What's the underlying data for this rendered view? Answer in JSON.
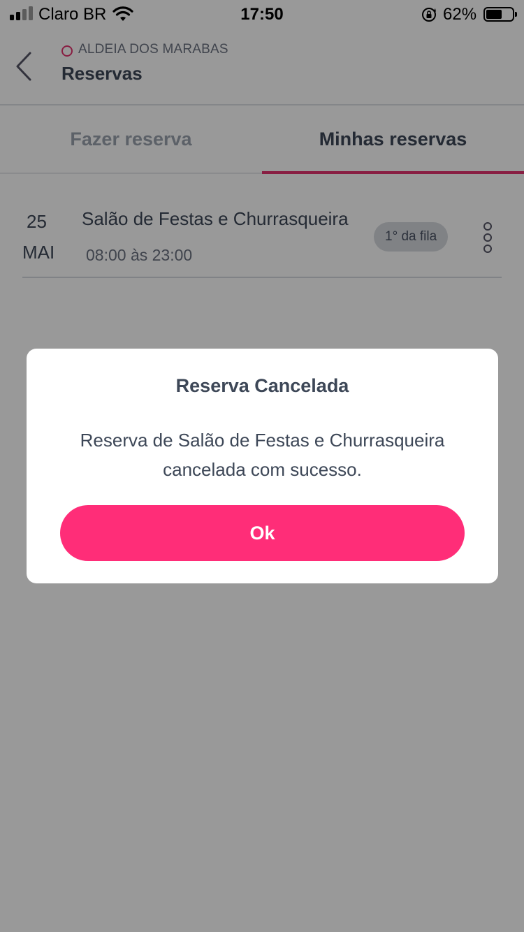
{
  "status_bar": {
    "carrier": "Claro BR",
    "time": "17:50",
    "battery_percent": "62%",
    "battery_level": 0.62,
    "signal_bars_active": 2,
    "signal_bars_total": 4
  },
  "header": {
    "condo_name": "ALDEIA DOS MARABAS",
    "title": "Reservas",
    "back_icon": "chevron-left-icon"
  },
  "tabs": [
    {
      "label": "Fazer reserva",
      "active": false
    },
    {
      "label": "Minhas reservas",
      "active": true
    }
  ],
  "reservations": [
    {
      "day": "25",
      "month": "MAI",
      "name": "Salão de Festas e Churrasqueira",
      "time": "08:00 às 23:00",
      "badge": "1° da fila",
      "menu_icon": "vertical-dots-icon"
    }
  ],
  "modal": {
    "title": "Reserva Cancelada",
    "message": "Reserva de Salão de Festas e Churrasqueira cancelada com sucesso.",
    "ok_label": "Ok"
  },
  "colors": {
    "accent": "#e3336f",
    "button": "#ff2d78",
    "text_dark": "#3d4757",
    "text_muted": "#9aa2ae",
    "badge_bg": "#d6d9de"
  }
}
